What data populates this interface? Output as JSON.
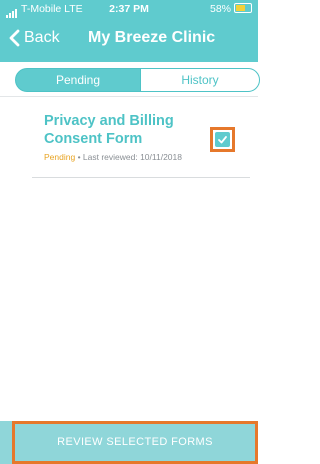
{
  "status_bar": {
    "carrier": "T-Mobile  LTE",
    "time": "2:37 PM",
    "battery": "58%"
  },
  "nav": {
    "back_label": "Back",
    "title": "My Breeze Clinic"
  },
  "tabs": [
    {
      "label": "Pending",
      "active": true
    },
    {
      "label": "History",
      "active": false
    }
  ],
  "forms": [
    {
      "title": "Privacy and Billing Consent Form",
      "status": "Pending",
      "meta": "• Last reviewed: 10/11/2018",
      "selected": true
    }
  ],
  "footer": {
    "button_label": "REVIEW SELECTED FORMS"
  },
  "colors": {
    "header": "#5fcbce",
    "accent": "#4ec3c6",
    "pending": "#e8a423",
    "highlight": "#e6782b",
    "footer": "#8fd6d9"
  }
}
